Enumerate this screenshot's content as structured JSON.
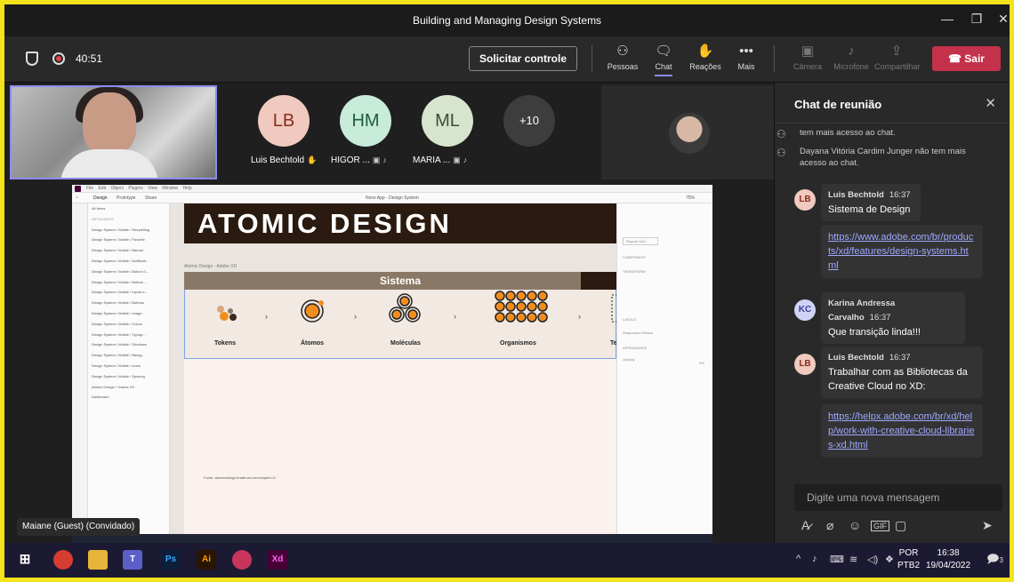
{
  "window": {
    "title": "Building and Managing Design Systems"
  },
  "toolbar": {
    "timer": "40:51",
    "request_control": "Solicitar controle",
    "buttons": [
      {
        "label": "Pessoas",
        "icon": "people-icon"
      },
      {
        "label": "Chat",
        "icon": "chat-icon"
      },
      {
        "label": "Reações",
        "icon": "reactions-icon"
      },
      {
        "label": "Mais",
        "icon": "more-icon"
      },
      {
        "label": "Câmera",
        "icon": "camera-off-icon"
      },
      {
        "label": "Microfone",
        "icon": "mic-off-icon"
      },
      {
        "label": "Compartilhar",
        "icon": "share-icon"
      }
    ],
    "leave": "Sair"
  },
  "participants": [
    {
      "initials": "LB",
      "name": "Luis Bechtold",
      "color": "#f0c9bf",
      "text": "#8a2c1c"
    },
    {
      "initials": "HM",
      "name": "HIGOR ...",
      "color": "#c9ebd9",
      "text": "#1f5e3b"
    },
    {
      "initials": "ML",
      "name": "MARIA ...",
      "color": "#d7e5cf",
      "text": "#3c4e32"
    },
    {
      "initials": "+10",
      "name": "",
      "color": "#3d3d3d",
      "text": "#ffffff"
    }
  ],
  "guest_label": "Maiane (Guest) (Convidado)",
  "shared": {
    "menu": [
      "File",
      "Edit",
      "Object",
      "Plugins",
      "View",
      "Window",
      "Help"
    ],
    "tabs": [
      "Design",
      "Prototype",
      "Share"
    ],
    "doc_title": "Novo App - Design System",
    "zoom": "75%",
    "search": "All Items",
    "assets_label": "ARTBOARDS",
    "layers": [
      "Design System / Mobile / Storytelling",
      "Design System / Mobile / Favorite",
      "Design System / Mobile / Banner",
      "Design System / Mobile / Notificati...",
      "Design System / Mobile / Button G...",
      "Design System / Mobile / Bottom ...",
      "Design System / Mobile / Inputs e...",
      "Design System / Mobile / Buttons",
      "Design System / Mobile / Image...",
      "Design System / Mobile / Colors",
      "Design System / Mobile / Typogr...",
      "Design System / Mobile / Shadows",
      "Design System / Mobile / Backg...",
      "Design System / Mobile / Icons",
      "Design System / Mobile / Spacing",
      "Atomic Design + Adobe XD",
      "Dashboard"
    ],
    "heading": "ATOMIC DESIGN",
    "artboard_label": "Atomic Design - Adobe XD",
    "section": "Sistema",
    "stages": [
      "Tokens",
      "Átomos",
      "Moléculas",
      "Organismos",
      "Te"
    ],
    "footer": "Fonte: atomicdesign.bradfrost.com/chapter-2/",
    "right_panel": [
      "COMPONENT",
      "TRANSFORM",
      "LAYOUT",
      "Responsive Resize",
      "APPEARANCE",
      "Opacity",
      "0%"
    ],
    "repeat_grid": "Repeat Grid"
  },
  "chat": {
    "title": "Chat de reunião",
    "system": [
      {
        "text": "tem mais acesso ao chat."
      },
      {
        "text": "Dayana Vitória Cardim Junger não tem mais acesso ao chat."
      }
    ],
    "messages": [
      {
        "initials": "LB",
        "author": "Luis Bechtold",
        "time": "16:37",
        "text": "Sistema de Design",
        "link": "https://www.adobe.com/br/products/xd/features/design-systems.html"
      },
      {
        "initials": "KC",
        "author": "Karina Andressa Carvalho",
        "time": "16:37",
        "text": "Que transição linda!!!"
      },
      {
        "initials": "LB",
        "author": "Luis Bechtold",
        "time": "16:37",
        "text": "Trabalhar com as Bibliotecas da Creative Cloud no XD:",
        "link": "https://helpx.adobe.com/br/xd/help/work-with-creative-cloud-libraries-xd.html"
      }
    ],
    "compose_placeholder": "Digite uma nova mensagem"
  },
  "taskbar": {
    "apps": [
      {
        "label": "",
        "icon": "chrome-icon",
        "color": "#d63c2f"
      },
      {
        "label": "",
        "icon": "file-explorer-icon",
        "color": "#e8b43a"
      },
      {
        "label": "T",
        "icon": "teams-icon",
        "color": "#5b5fc7"
      },
      {
        "label": "Ps",
        "icon": "photoshop-icon",
        "color": "#0b1e3a"
      },
      {
        "label": "Ai",
        "icon": "illustrator-icon",
        "color": "#2a1600"
      },
      {
        "label": "",
        "icon": "creative-cloud-icon",
        "color": "#c7355d"
      },
      {
        "label": "Xd",
        "icon": "xd-icon",
        "color": "#470137"
      }
    ],
    "lang1": "POR",
    "lang2": "PTB2",
    "time": "16:38",
    "date": "19/04/2022",
    "notif_count": "3"
  }
}
